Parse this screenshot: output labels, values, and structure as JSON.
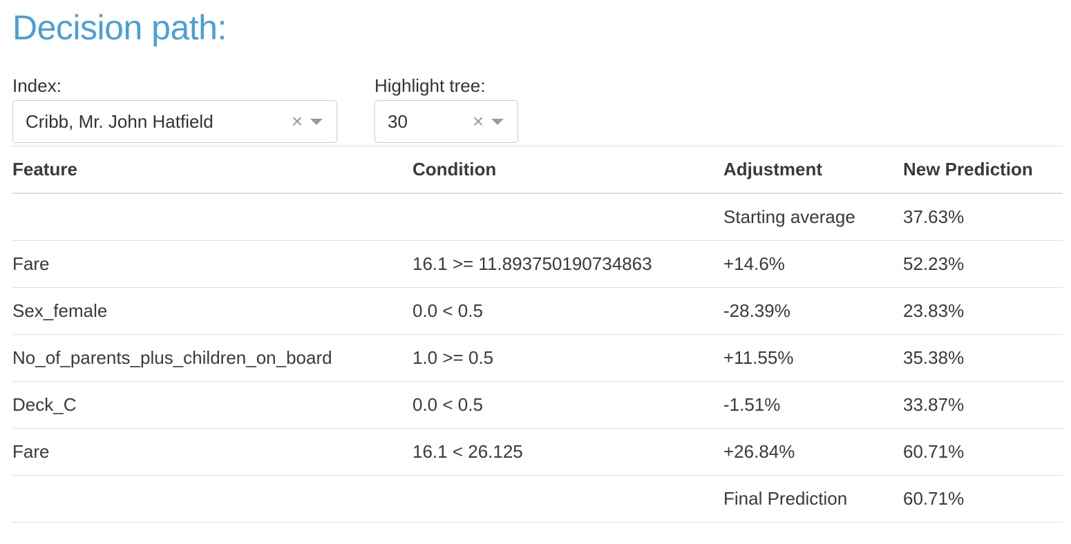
{
  "header": {
    "title": "Decision path:"
  },
  "controls": {
    "index_label": "Index:",
    "index_value": "Cribb, Mr. John Hatfield",
    "tree_label": "Highlight tree:",
    "tree_value": "30",
    "clear_symbol": "×",
    "icons": [
      "clear-icon",
      "chevron-down-icon"
    ]
  },
  "table": {
    "columns": [
      "Feature",
      "Condition",
      "Adjustment",
      "New Prediction"
    ],
    "rows": [
      {
        "feature": "",
        "condition": "",
        "adjustment": "Starting average",
        "prediction": "37.63%"
      },
      {
        "feature": "Fare",
        "condition": "16.1 >= 11.893750190734863",
        "adjustment": "+14.6%",
        "prediction": "52.23%"
      },
      {
        "feature": "Sex_female",
        "condition": "0.0 < 0.5",
        "adjustment": "-28.39%",
        "prediction": "23.83%"
      },
      {
        "feature": "No_of_parents_plus_children_on_board",
        "condition": "1.0 >= 0.5",
        "adjustment": "+11.55%",
        "prediction": "35.38%"
      },
      {
        "feature": "Deck_C",
        "condition": "0.0 < 0.5",
        "adjustment": "-1.51%",
        "prediction": "33.87%"
      },
      {
        "feature": "Fare",
        "condition": "16.1 < 26.125",
        "adjustment": "+26.84%",
        "prediction": "60.71%"
      },
      {
        "feature": "",
        "condition": "",
        "adjustment": "Final Prediction",
        "prediction": "60.71%"
      }
    ]
  },
  "colors": {
    "title": "#4a9fd8",
    "text": "#3a3a3a",
    "border": "#dddddd",
    "icon": "#999999"
  }
}
